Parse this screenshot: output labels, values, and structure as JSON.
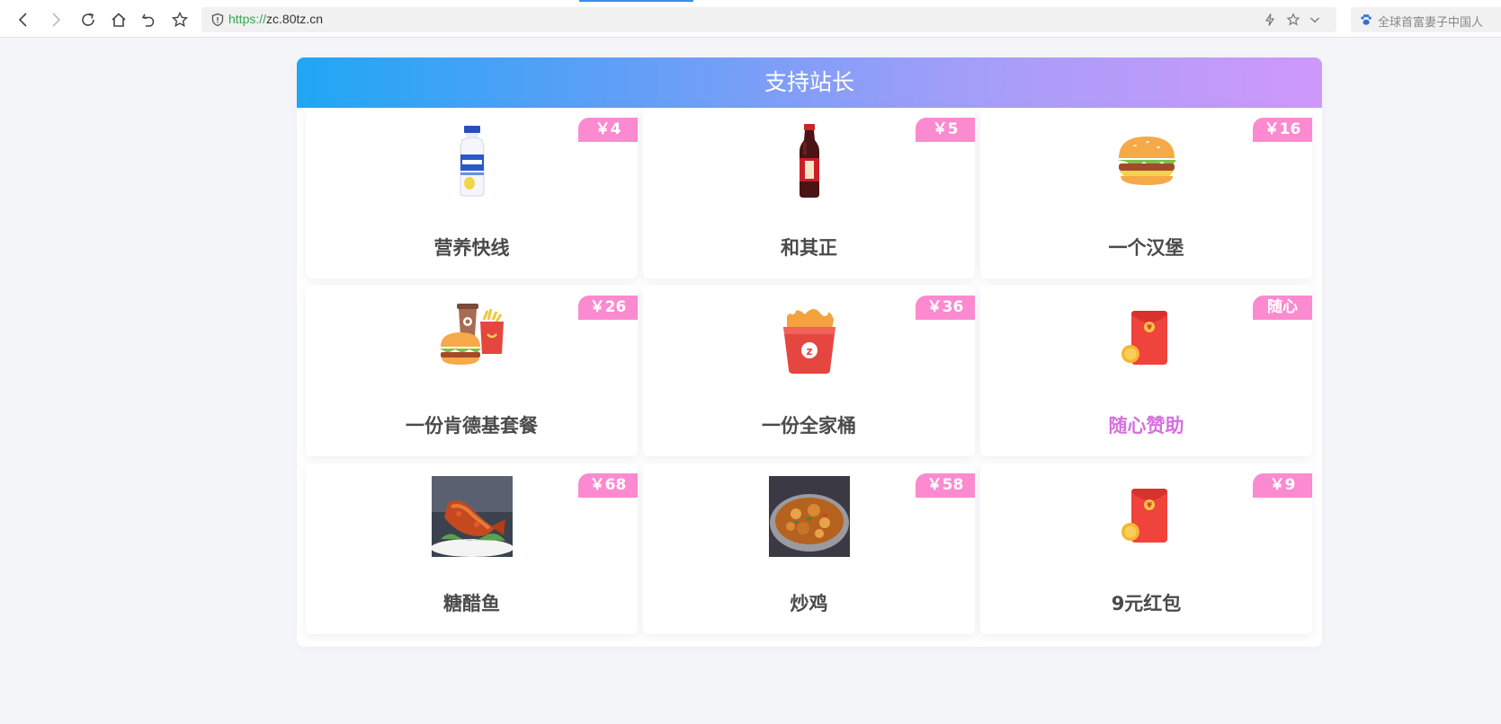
{
  "browser": {
    "url_scheme": "https://",
    "url_host": "zc.80tz.cn",
    "search_placeholder": "全球首富妻子中国人"
  },
  "page": {
    "title": "支持站长"
  },
  "items": [
    {
      "name": "营养快线",
      "price": "￥4",
      "icon": "milk-bottle-icon"
    },
    {
      "name": "和其正",
      "price": "￥5",
      "icon": "tea-bottle-icon"
    },
    {
      "name": "一个汉堡",
      "price": "￥16",
      "icon": "burger-icon"
    },
    {
      "name": "一份肯德基套餐",
      "price": "￥26",
      "icon": "combo-meal-icon"
    },
    {
      "name": "一份全家桶",
      "price": "￥36",
      "icon": "chicken-bucket-icon"
    },
    {
      "name": "随心赞助",
      "price": "随心",
      "icon": "red-envelope-icon"
    },
    {
      "name": "糖醋鱼",
      "price": "￥68",
      "icon": "sweet-sour-fish-photo"
    },
    {
      "name": "炒鸡",
      "price": "￥58",
      "icon": "fried-chicken-photo"
    },
    {
      "name": "9元红包",
      "price": "￥9",
      "icon": "red-envelope-icon"
    }
  ],
  "colors": {
    "price_badge": "#fb8ad0",
    "accent_name": "#d86fe0",
    "banner_start": "#1fa7f4",
    "banner_end": "#cf98fb"
  }
}
